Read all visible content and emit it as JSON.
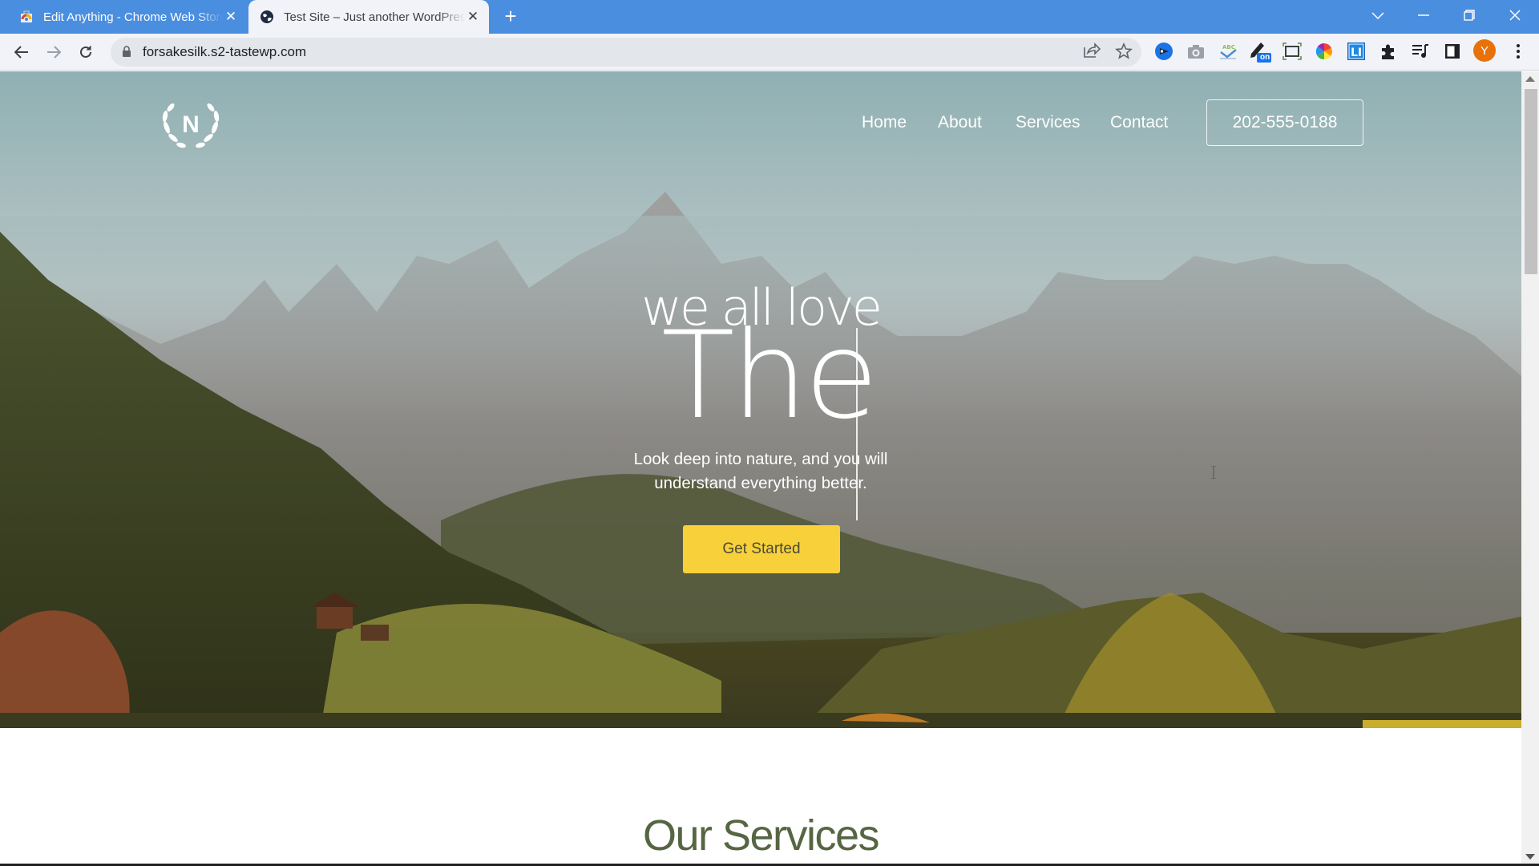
{
  "browser": {
    "tabs": [
      {
        "title": "Edit Anything - Chrome Web Store",
        "favicon": "chrome-web-store-icon",
        "active": false
      },
      {
        "title": "Test Site – Just another WordPress site",
        "favicon": "wordpress-globe-icon",
        "active": true
      }
    ],
    "new_tab_label": "+",
    "close_glyph": "✕",
    "address": "forsakesilk.s2-tastewp.com",
    "window_controls": [
      "tab-search",
      "minimize",
      "restore",
      "close"
    ],
    "extensions": [
      "screencastify-icon",
      "camera-icon",
      "spellcheck-abc-icon",
      "pencil-on-icon",
      "screenshot-frame-icon",
      "color-wheel-icon",
      "li-icon",
      "puzzle-extensions-icon",
      "media-queue-icon",
      "side-panel-icon"
    ],
    "extension_badge": "on",
    "profile_initial": "Y",
    "profile_color": "#e8710a"
  },
  "site": {
    "logo_letter": "N",
    "nav": [
      {
        "label": "Home"
      },
      {
        "label": "About"
      },
      {
        "label": "Services"
      },
      {
        "label": "Contact"
      }
    ],
    "phone": "202-555-0188",
    "hero": {
      "heading_small": "we all love",
      "heading_big": "The",
      "tagline_line1": "Look deep into nature, and you will",
      "tagline_line2": "understand everything better.",
      "cta_label": "Get Started"
    },
    "services_title": "Our Services",
    "colors": {
      "cta": "#f8d03a",
      "section_title": "#566642",
      "tab_strip": "#4a8ee0"
    }
  }
}
